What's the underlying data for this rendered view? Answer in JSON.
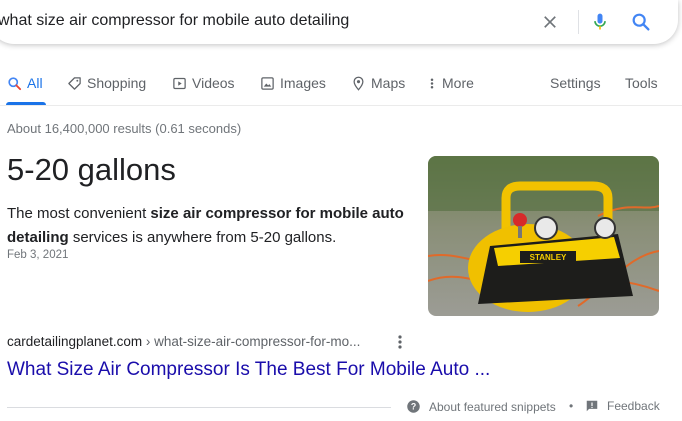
{
  "search": {
    "query": "what size air compressor for mobile auto detailing"
  },
  "tabs": [
    {
      "label": "All",
      "icon": "search-icon",
      "active": true
    },
    {
      "label": "Shopping",
      "icon": "tag-icon"
    },
    {
      "label": "Videos",
      "icon": "play-icon"
    },
    {
      "label": "Images",
      "icon": "image-icon"
    },
    {
      "label": "Maps",
      "icon": "map-pin-icon"
    },
    {
      "label": "More",
      "icon": "more-vert-icon"
    }
  ],
  "tools": {
    "settings": "Settings",
    "tools": "Tools"
  },
  "result_stats": "About 16,400,000 results (0.61 seconds)",
  "featured": {
    "answer": "5-20 gallons",
    "snippet_pre": "The most convenient ",
    "snippet_bold": "size air compressor for mobile auto detailing",
    "snippet_post": " services is anywhere from 5-20 gallons.",
    "date": "Feb 3, 2021",
    "cite_domain": "cardetailingplanet.com",
    "cite_path": " › what-size-air-compressor-for-mo...",
    "link_title": "What Size Air Compressor Is The Best For Mobile Auto ...",
    "image_brand": "STANLEY"
  },
  "footer": {
    "about": "About featured snippets",
    "separator": "•",
    "feedback": "Feedback"
  },
  "colors": {
    "accent": "#1a73e8",
    "link": "#1a0dab",
    "muted": "#70757a"
  }
}
